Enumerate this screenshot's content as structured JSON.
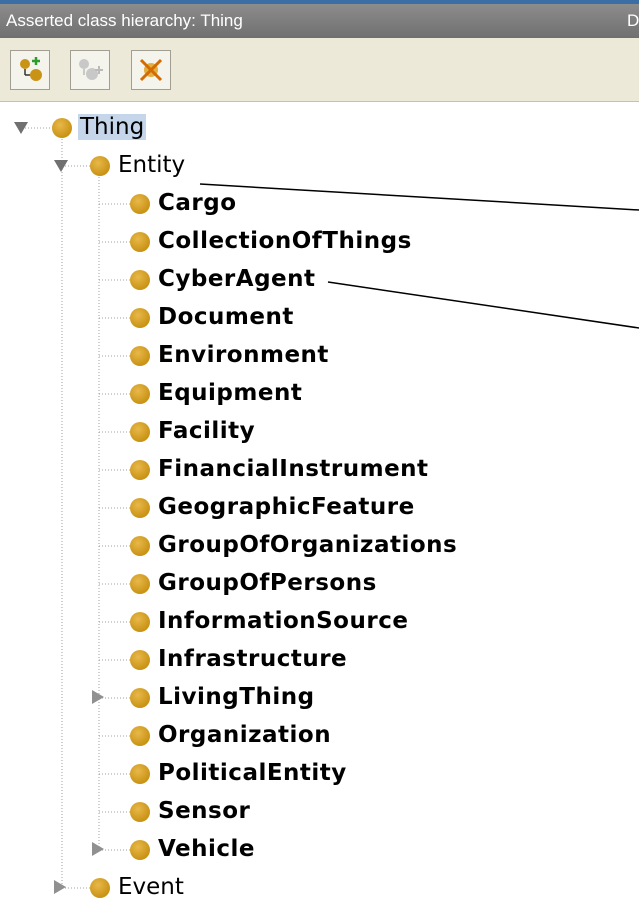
{
  "panel": {
    "title": "Asserted class hierarchy: Thing",
    "title_right": "D"
  },
  "toolbar": {
    "buttons": [
      {
        "icon": "add-subclass-icon",
        "enabled": true
      },
      {
        "icon": "add-sibling-class-icon",
        "enabled": false
      },
      {
        "icon": "delete-class-icon",
        "enabled": true
      }
    ]
  },
  "tree": {
    "root": "Thing",
    "entity": "Entity",
    "children": [
      {
        "label": "Cargo",
        "expandable": false
      },
      {
        "label": "CollectionOfThings",
        "expandable": false
      },
      {
        "label": "CyberAgent",
        "expandable": false
      },
      {
        "label": "Document",
        "expandable": false
      },
      {
        "label": "Environment",
        "expandable": false
      },
      {
        "label": "Equipment",
        "expandable": false
      },
      {
        "label": "Facility",
        "expandable": false
      },
      {
        "label": "FinancialInstrument",
        "expandable": false
      },
      {
        "label": "GeographicFeature",
        "expandable": false
      },
      {
        "label": "GroupOfOrganizations",
        "expandable": false
      },
      {
        "label": "GroupOfPersons",
        "expandable": false
      },
      {
        "label": "InformationSource",
        "expandable": false
      },
      {
        "label": "Infrastructure",
        "expandable": false
      },
      {
        "label": "LivingThing",
        "expandable": true
      },
      {
        "label": "Organization",
        "expandable": false
      },
      {
        "label": "PoliticalEntity",
        "expandable": false
      },
      {
        "label": "Sensor",
        "expandable": false
      },
      {
        "label": "Vehicle",
        "expandable": true
      }
    ],
    "sibling": "Event"
  },
  "colors": {
    "class_bullet": "#d4a020",
    "selection": "#c5d6ea",
    "title_bar": "#7a7a7a",
    "toolbar_bg": "#ece9d8"
  }
}
